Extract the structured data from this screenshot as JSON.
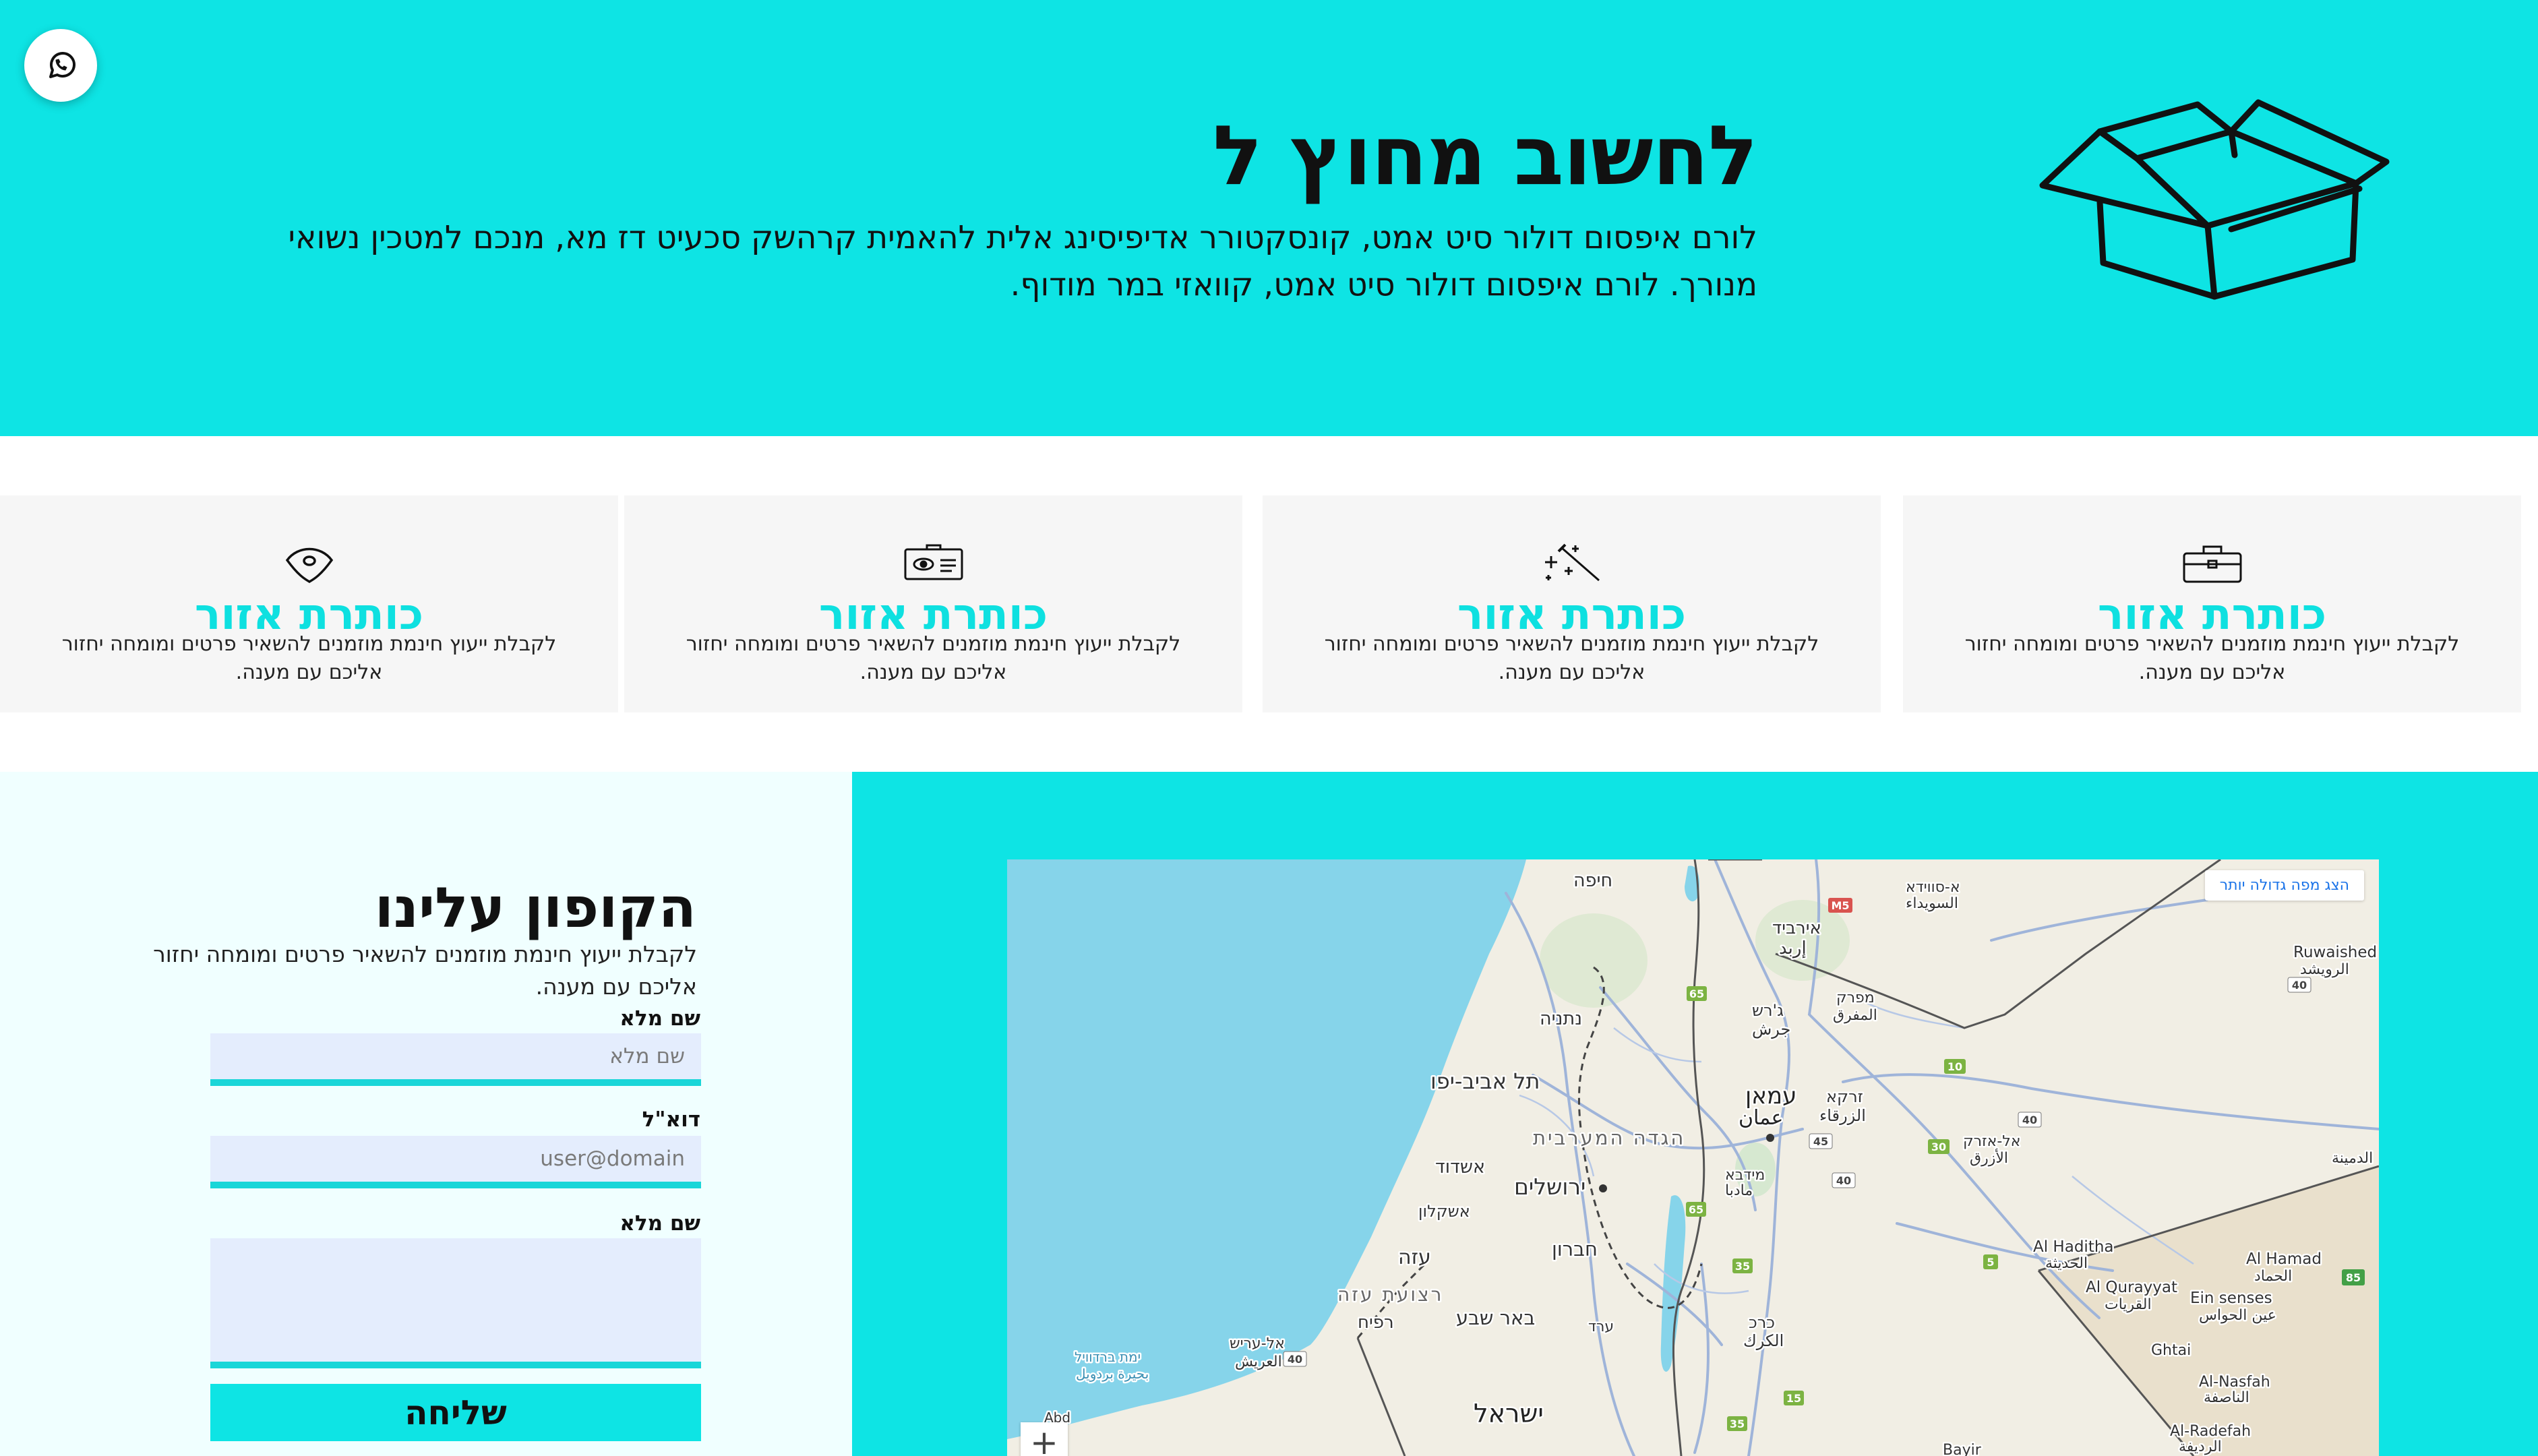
{
  "hero": {
    "title": "לחשוב מחוץ ל",
    "text": "לורם איפסום דולור סיט אמט, קונסקטורר אדיפיסינג אלית להאמית קרהשק סכעיט דז מא, מנכם למטכין נשואי מנורך. לורם איפסום דולור סיט אמט, קוואזי במר מודוף.",
    "icon": "open-box-icon"
  },
  "whatsapp": {
    "icon": "whatsapp-icon"
  },
  "features": [
    {
      "icon": "briefcase-icon",
      "title": "כותרת אזור",
      "text": "לקבלת ייעוץ חינמת מוזמנים להשאיר פרטים ומומחה יחזור אליכם עם מענה."
    },
    {
      "icon": "magic-wand-icon",
      "title": "כותרת אזור",
      "text": "לקבלת ייעוץ חינמת מוזמנים להשאיר פרטים ומומחה יחזור אליכם עם מענה."
    },
    {
      "icon": "id-card-icon",
      "title": "כותרת אזור",
      "text": "לקבלת ייעוץ חינמת מוזמנים להשאיר פרטים ומומחה יחזור אליכם עם מענה."
    },
    {
      "icon": "eye-icon",
      "title": "כותרת אזור",
      "text": "לקבלת ייעוץ חינמת מוזמנים להשאיר פרטים ומומחה יחזור אליכם עם מענה."
    }
  ],
  "contact": {
    "title": "הקופון עלינו",
    "text": "לקבלת ייעוץ חינמת מוזמנים להשאיר פרטים ומומחה יחזור אליכם עם מענה.",
    "name_label": "שם מלא",
    "name_placeholder": "שם מלא",
    "email_label": "דוא\"ל",
    "email_placeholder": "user@domain",
    "message_label": "שם מלא",
    "submit_label": "שליחה"
  },
  "map": {
    "view_larger": "הצג מפה גדולה יותר",
    "zoom_in": "+",
    "labels": [
      "חיפה",
      "נתניה",
      "תל אביב-יפו",
      "אשדוד",
      "אשקלון",
      "עזה",
      "רפיח",
      "ירושלים",
      "חברון",
      "באר שבע",
      "ישראל",
      "הגדה המערבית",
      "רצועת עזה",
      "עמאן",
      "עמאן",
      "זרקא",
      "الزرقاء",
      "אירביד",
      "إربد",
      "ג'רש",
      "جرش",
      "מפרק",
      "المفرق",
      "מידבא",
      "مادبا",
      "כרכ",
      "الكرك",
      "ערד",
      "אל-עריש",
      "العريش",
      "ימת ברדוויל",
      "بحيرة بردويل",
      "א-סווידא",
      "السويداء",
      "Ruwaished",
      "الرويشد",
      "Al Haditha",
      "الحديثة",
      "Al Qurayyat",
      "القريات",
      "Ein senses",
      "عين الحواس",
      "Ghtai",
      "Al Hamad",
      "الحماد",
      "Al-Nasfah",
      "الناصفة",
      "Al-Radefah",
      "الرديفة",
      "Bayir",
      "אל-אזרק",
      "الأزرق",
      "الدمينة",
      "Abd",
      "بئ"
    ],
    "road_numbers": [
      "M5",
      "65",
      "10",
      "40",
      "30",
      "45",
      "40",
      "40",
      "5",
      "65",
      "35",
      "15",
      "35",
      "85",
      "40"
    ]
  }
}
